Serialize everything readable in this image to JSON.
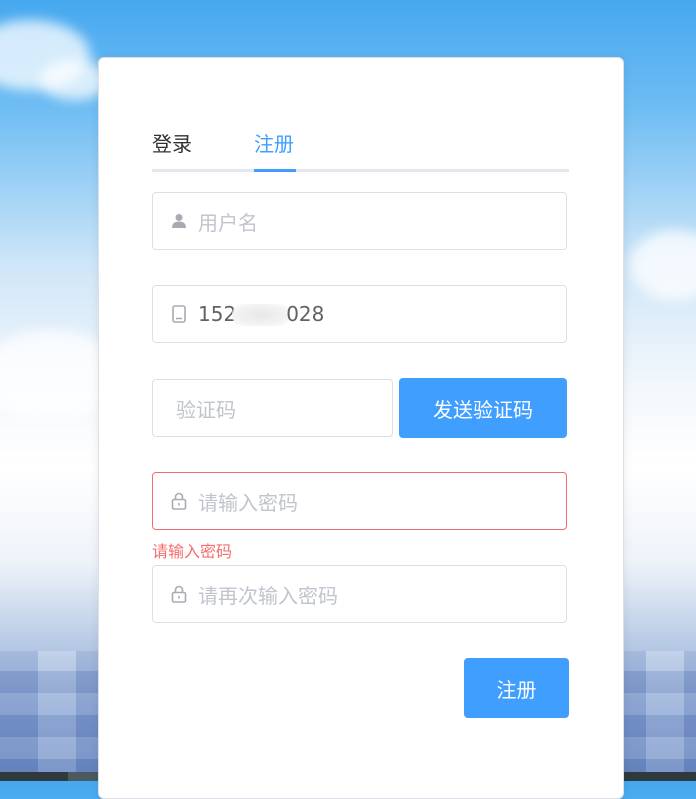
{
  "tabs": {
    "login": "登录",
    "register": "注册"
  },
  "form": {
    "username_placeholder": "用户名",
    "phone_prefix": "152",
    "phone_suffix": "028",
    "code_placeholder": "验证码",
    "send_code_label": "发送验证码",
    "password_placeholder": "请输入密码",
    "password_error": "请输入密码",
    "confirm_placeholder": "请再次输入密码",
    "submit_label": "注册"
  },
  "colors": {
    "accent": "#409eff",
    "error": "#f56c6c",
    "placeholder": "#c0c4cc",
    "border": "#dcdfe6"
  },
  "icons": {
    "username": "user-icon",
    "phone": "mobile-phone-icon",
    "password": "lock-icon",
    "confirm": "lock-icon"
  }
}
